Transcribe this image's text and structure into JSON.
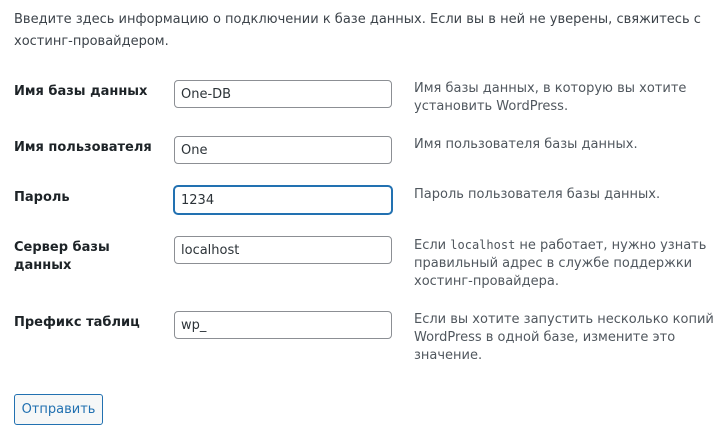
{
  "intro": "Введите здесь информацию о подключении к базе данных. Если вы в ней не уверены, свяжитесь с хостинг-провайдером.",
  "fields": [
    {
      "label": "Имя базы данных",
      "value": "One-DB",
      "description": "Имя базы данных, в которую вы хотите установить WordPress."
    },
    {
      "label": "Имя пользователя",
      "value": "One",
      "description": "Имя пользователя базы данных."
    },
    {
      "label": "Пароль",
      "value": "1234",
      "description": "Пароль пользователя базы данных."
    },
    {
      "label": "Сервер базы данных",
      "value": "localhost",
      "description_before": "Если ",
      "description_code": "localhost",
      "description_after": " не работает, нужно узнать правильный адрес в службе поддержки хостинг-провайдера."
    },
    {
      "label": "Префикс таблиц",
      "value": "wp_",
      "description": "Если вы хотите запустить несколько копий WordPress в одной базе, измените это значение."
    }
  ],
  "submit_label": "Отправить",
  "colors": {
    "accent": "#2271b1",
    "text": "#3c434a",
    "label": "#1d2327"
  }
}
